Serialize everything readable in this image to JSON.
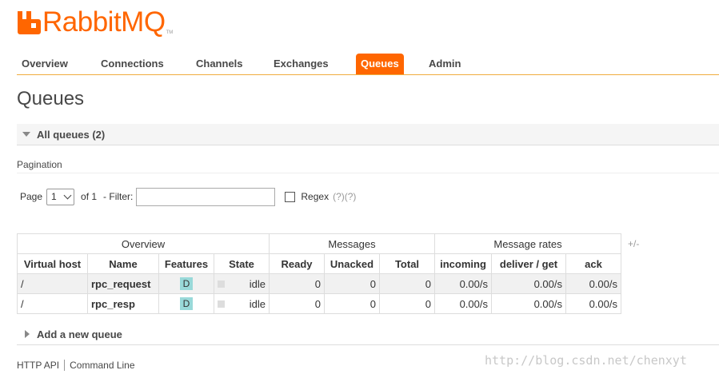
{
  "brand": {
    "name": "RabbitMQ",
    "tm": "TM",
    "color": "#ff6600"
  },
  "nav": {
    "items": [
      "Overview",
      "Connections",
      "Channels",
      "Exchanges",
      "Queues",
      "Admin"
    ],
    "active": "Queues"
  },
  "page": {
    "title": "Queues"
  },
  "all_queues": {
    "label": "All queues (2)"
  },
  "pagination": {
    "label": "Pagination",
    "page_label": "Page",
    "page_value": "1",
    "of_label": "of 1",
    "filter_label": "- Filter:",
    "filter_value": "",
    "regex_label": "Regex",
    "help": "(?)(?)"
  },
  "table": {
    "groups": [
      "Overview",
      "Messages",
      "Message rates"
    ],
    "toggle": "+/-",
    "columns": [
      "Virtual host",
      "Name",
      "Features",
      "State",
      "Ready",
      "Unacked",
      "Total",
      "incoming",
      "deliver / get",
      "ack"
    ],
    "rows": [
      {
        "vhost": "/",
        "name": "rpc_request",
        "feature": "D",
        "state": "idle",
        "ready": "0",
        "unacked": "0",
        "total": "0",
        "incoming": "0.00/s",
        "deliver_get": "0.00/s",
        "ack": "0.00/s"
      },
      {
        "vhost": "/",
        "name": "rpc_resp",
        "feature": "D",
        "state": "idle",
        "ready": "0",
        "unacked": "0",
        "total": "0",
        "incoming": "0.00/s",
        "deliver_get": "0.00/s",
        "ack": "0.00/s"
      }
    ]
  },
  "add_queue": {
    "label": "Add a new queue"
  },
  "footer": {
    "http_api": "HTTP API",
    "command_line": "Command Line"
  },
  "watermark": "http://blog.csdn.net/chenxyt"
}
